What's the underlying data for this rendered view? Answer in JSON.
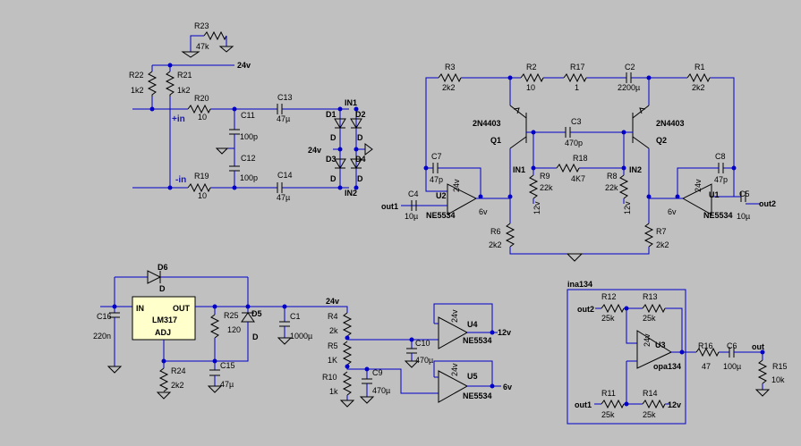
{
  "components": {
    "R23": {
      "ref": "R23",
      "val": "47k"
    },
    "R22": {
      "ref": "R22",
      "val": "1k2"
    },
    "R21": {
      "ref": "R21",
      "val": "1k2"
    },
    "R20": {
      "ref": "R20",
      "val": "10"
    },
    "R19": {
      "ref": "R19",
      "val": "10"
    },
    "C11": {
      "ref": "C11",
      "val": "100p"
    },
    "C12": {
      "ref": "C12",
      "val": "100p"
    },
    "C13": {
      "ref": "C13",
      "val": "47µ"
    },
    "C14": {
      "ref": "C14",
      "val": "47µ"
    },
    "D1": {
      "ref": "D1",
      "val": "D"
    },
    "D2": {
      "ref": "D2",
      "val": "D"
    },
    "D3": {
      "ref": "D3",
      "val": "D"
    },
    "D4": {
      "ref": "D4",
      "val": "D"
    },
    "R3": {
      "ref": "R3",
      "val": "2k2"
    },
    "R2": {
      "ref": "R2",
      "val": "10"
    },
    "R17": {
      "ref": "R17",
      "val": "1"
    },
    "C2": {
      "ref": "C2",
      "val": "2200µ"
    },
    "R1": {
      "ref": "R1",
      "val": "2k2"
    },
    "Q1": {
      "ref": "Q1",
      "val": "2N4403"
    },
    "Q2": {
      "ref": "Q2",
      "val": "2N4403"
    },
    "C3": {
      "ref": "C3",
      "val": "470p"
    },
    "R18": {
      "ref": "R18",
      "val": "4K7"
    },
    "R9": {
      "ref": "R9",
      "val": "22k"
    },
    "R8": {
      "ref": "R8",
      "val": "22k"
    },
    "C7": {
      "ref": "C7",
      "val": "47p"
    },
    "C8": {
      "ref": "C8",
      "val": "47p"
    },
    "C4": {
      "ref": "C4",
      "val": "10µ"
    },
    "C5": {
      "ref": "C5",
      "val": "10µ"
    },
    "U2": {
      "ref": "U2",
      "val": "NE5534"
    },
    "U1": {
      "ref": "U1",
      "val": "NE5534"
    },
    "R6": {
      "ref": "R6",
      "val": "2k2"
    },
    "R7": {
      "ref": "R7",
      "val": "2k2"
    },
    "D6": {
      "ref": "D6",
      "val": "D"
    },
    "D5": {
      "ref": "D5",
      "val": "D"
    },
    "C16": {
      "ref": "C16",
      "val": "220n"
    },
    "R25": {
      "ref": "R25",
      "val": "120"
    },
    "R24": {
      "ref": "R24",
      "val": "2k2"
    },
    "C15": {
      "ref": "C15",
      "val": "47µ"
    },
    "C1": {
      "ref": "C1",
      "val": "1000µ"
    },
    "R4": {
      "ref": "R4",
      "val": "2k"
    },
    "R5": {
      "ref": "R5",
      "val": "1K"
    },
    "R10": {
      "ref": "R10",
      "val": "1k"
    },
    "C10": {
      "ref": "C10",
      "val": "470µ"
    },
    "C9": {
      "ref": "C9",
      "val": "470µ"
    },
    "U4": {
      "ref": "U4",
      "val": "NE5534"
    },
    "U5": {
      "ref": "U5",
      "val": "NE5534"
    },
    "R12": {
      "ref": "R12",
      "val": "25k"
    },
    "R13": {
      "ref": "R13",
      "val": "25k"
    },
    "R11": {
      "ref": "R11",
      "val": "25k"
    },
    "R14": {
      "ref": "R14",
      "val": "25k"
    },
    "U3": {
      "ref": "U3",
      "val": "opa134"
    },
    "R16": {
      "ref": "R16",
      "val": "47"
    },
    "C6": {
      "ref": "C6",
      "val": "100µ"
    },
    "R15": {
      "ref": "R15",
      "val": "10k"
    }
  },
  "regulator": {
    "name": "LM317",
    "in": "IN",
    "out": "OUT",
    "adj": "ADJ"
  },
  "nets": {
    "v24": "24v",
    "v12": "12v",
    "v6": "6v",
    "in_pos": "+in",
    "in_neg": "-in",
    "in1": "IN1",
    "in2": "IN2",
    "out1": "out1",
    "out2": "out2",
    "out": "out",
    "ina": "ina134"
  }
}
